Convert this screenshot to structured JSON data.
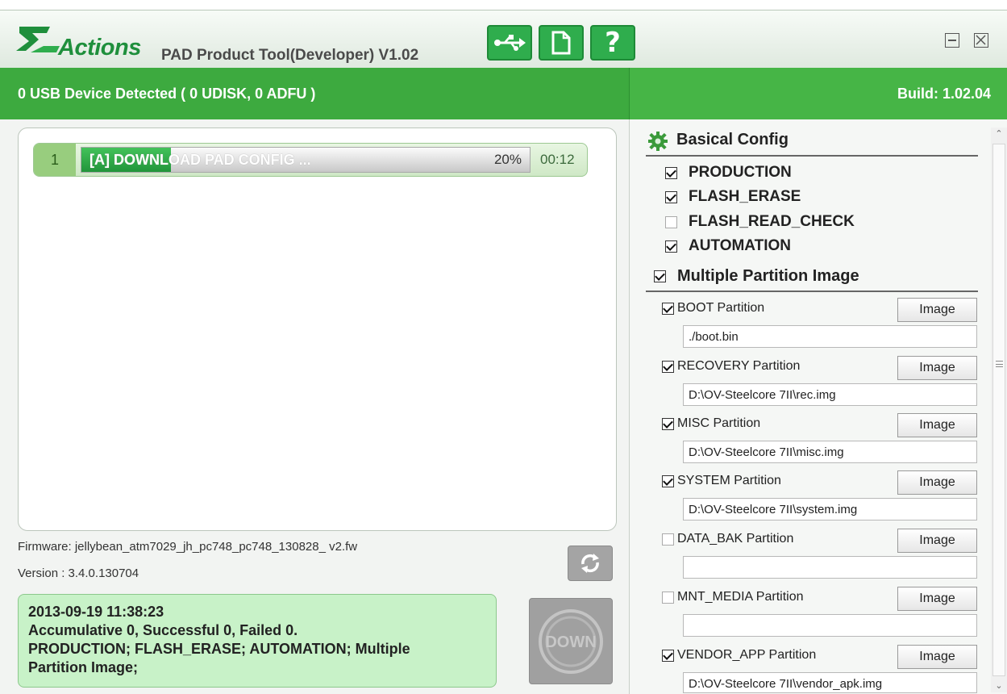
{
  "app": {
    "brand": "Actions",
    "title": "PAD Product Tool(Developer) V1.02",
    "toolbar_buttons": [
      {
        "icon": "usb-icon"
      },
      {
        "icon": "document-icon"
      },
      {
        "icon": "help-icon",
        "label": "?"
      }
    ]
  },
  "status": {
    "devices": "0 USB Device Detected ( 0 UDISK, 0 ADFU )",
    "build": "Build: 1.02.04"
  },
  "tasks": [
    {
      "num": "1",
      "label": "[A] DOWNLOAD PAD CONFIG ...",
      "percent_text": "20%",
      "progress": 0.2,
      "time": "00:12"
    }
  ],
  "info": {
    "firmware": "Firmware: jellybean_atm7029_jh_pc748_pc748_130828_ v2.fw",
    "version": "Version : 3.4.0.130704"
  },
  "log": {
    "lines": [
      "2013-09-19 11:38:23",
      "Accumulative 0, Successful 0, Failed 0.",
      "PRODUCTION; FLASH_ERASE; AUTOMATION; Multiple",
      "Partition Image;"
    ]
  },
  "down_button": {
    "label": "DOWN"
  },
  "config": {
    "basic_title": "Basical Config",
    "options": [
      {
        "label": "PRODUCTION",
        "checked": true
      },
      {
        "label": "FLASH_ERASE",
        "checked": true
      },
      {
        "label": "FLASH_READ_CHECK",
        "checked": false
      },
      {
        "label": "AUTOMATION",
        "checked": true
      }
    ],
    "multi_title": "Multiple Partition Image",
    "multi_checked": true,
    "image_button_label": "Image",
    "partitions": [
      {
        "label": "BOOT Partition",
        "checked": true,
        "path": "./boot.bin"
      },
      {
        "label": "RECOVERY Partition",
        "checked": true,
        "path": "D:\\OV-Steelcore 7II\\rec.img"
      },
      {
        "label": "MISC Partition",
        "checked": true,
        "path": "D:\\OV-Steelcore 7II\\misc.img"
      },
      {
        "label": "SYSTEM Partition",
        "checked": true,
        "path": "D:\\OV-Steelcore 7II\\system.img"
      },
      {
        "label": "DATA_BAK Partition",
        "checked": false,
        "path": ""
      },
      {
        "label": "MNT_MEDIA Partition",
        "checked": false,
        "path": ""
      },
      {
        "label": "VENDOR_APP Partition",
        "checked": true,
        "path": "D:\\OV-Steelcore 7II\\vendor_apk.img"
      }
    ]
  },
  "colors": {
    "accent": "#3daa3f",
    "accent_dark": "#1f8f3c",
    "log_bg": "#c8f2c8"
  }
}
